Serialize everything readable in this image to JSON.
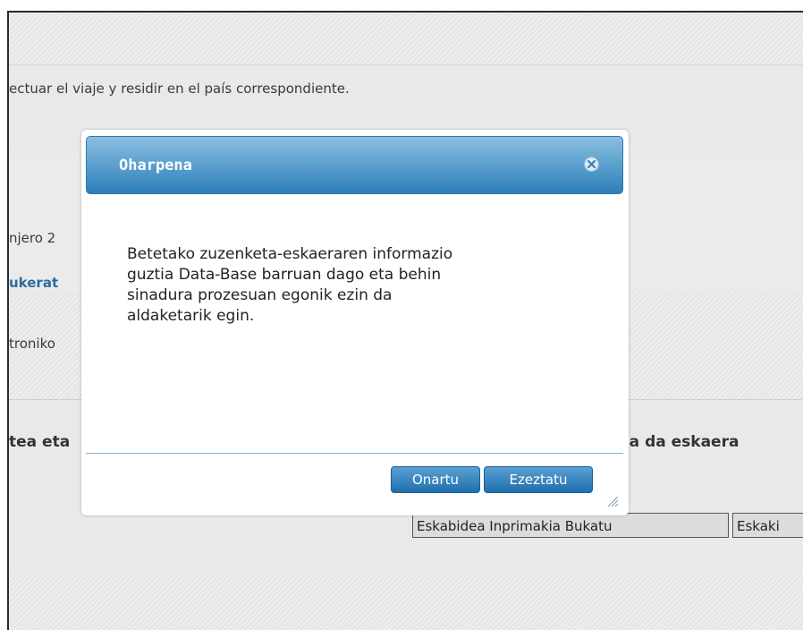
{
  "background": {
    "line1": "ectuar el viaje y residir en el país correspondiente.",
    "line2": "njero 2",
    "link1": "ukerat",
    "line3": "troniko",
    "bold_left": "tea eta",
    "bold_right": "oa da eskaera",
    "buttons": [
      "Eskabidea Inprimakia Bukatu",
      "Eskaki"
    ]
  },
  "modal": {
    "title": "Oharpena",
    "body_lines": [
      "Betetako zuzenketa-eskaeraren informazio",
      "guztia Data-Base barruan dago eta behin",
      "sinadura prozesuan egonik ezin da",
      "aldaketarik egin."
    ],
    "accept_label": "Onartu",
    "cancel_label": "Ezeztatu",
    "close_icon": "close-icon"
  },
  "colors": {
    "header_top": "#8cbfe0",
    "header_bottom": "#2c7fba",
    "button_blue": "#1f6fae",
    "link_blue": "#2f6b9a"
  }
}
